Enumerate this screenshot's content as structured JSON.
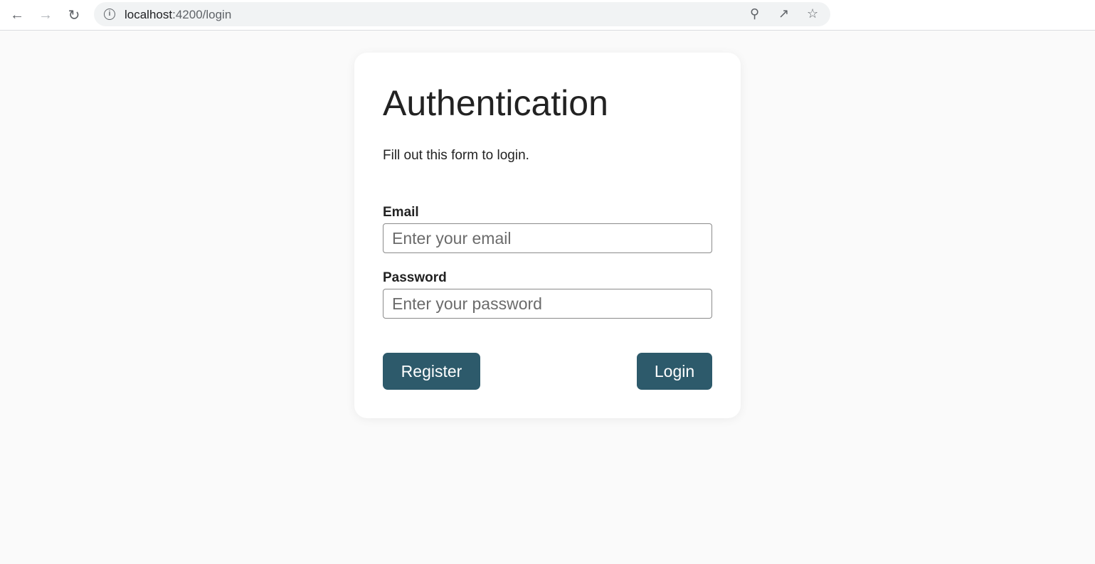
{
  "browser": {
    "url_host": "localhost",
    "url_path": ":4200/login"
  },
  "card": {
    "title": "Authentication",
    "subtitle": "Fill out this form to login.",
    "email_label": "Email",
    "email_placeholder": "Enter your email",
    "password_label": "Password",
    "password_placeholder": "Enter your password",
    "register_label": "Register",
    "login_label": "Login",
    "button_color": "#2d5a6b"
  }
}
